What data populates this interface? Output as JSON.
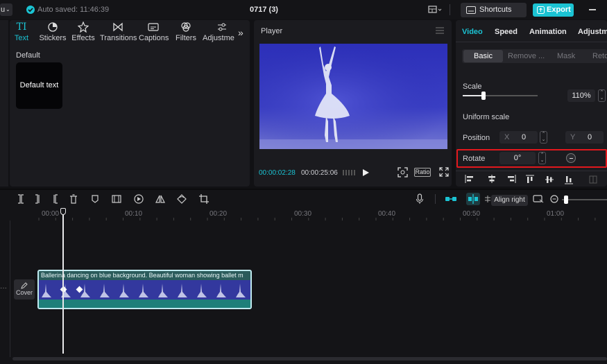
{
  "top_bar": {
    "menu_label": "u",
    "autosave": "Auto saved: 11:46:39",
    "project_title": "0717 (3)",
    "shortcuts_label": "Shortcuts",
    "export_label": "Export"
  },
  "media_tabs": [
    {
      "label": "Text",
      "icon": "text-icon"
    },
    {
      "label": "Stickers",
      "icon": "sticker-icon"
    },
    {
      "label": "Effects",
      "icon": "effects-icon"
    },
    {
      "label": "Transitions",
      "icon": "transitions-icon"
    },
    {
      "label": "Captions",
      "icon": "captions-icon"
    },
    {
      "label": "Filters",
      "icon": "filters-icon"
    },
    {
      "label": "Adjustme",
      "icon": "adjust-icon"
    }
  ],
  "text_panel": {
    "section_label": "Default",
    "card_label": "Default text"
  },
  "player": {
    "title": "Player",
    "current_time": "00:00:02:28",
    "total_time": "00:00:25:06",
    "ratio_label": "Ratio"
  },
  "inspector": {
    "tabs": [
      "Video",
      "Speed",
      "Animation",
      "Adjustm"
    ],
    "subtabs": [
      "Basic",
      "Remove ...",
      "Mask",
      "Reto"
    ],
    "scale_label": "Scale",
    "scale_value": "110%",
    "scale_fraction": 0.28,
    "uniform_scale_label": "Uniform scale",
    "position_label": "Position",
    "pos_x_label": "X",
    "pos_x_value": "0",
    "pos_y_label": "Y",
    "pos_y_value": "0",
    "rotate_label": "Rotate",
    "rotate_value": "0°"
  },
  "timeline": {
    "ruler_labels": [
      "00:00",
      "00:10",
      "00:20",
      "00:30",
      "00:40",
      "00:50",
      "01:00"
    ],
    "tooltip": "Align right",
    "clip_title": "Ballerina dancing on blue background. Beautiful woman showing ballet m",
    "cover_label": "Cover"
  },
  "colors": {
    "accent": "#1bc3d3",
    "highlight_box": "#e2181d"
  }
}
